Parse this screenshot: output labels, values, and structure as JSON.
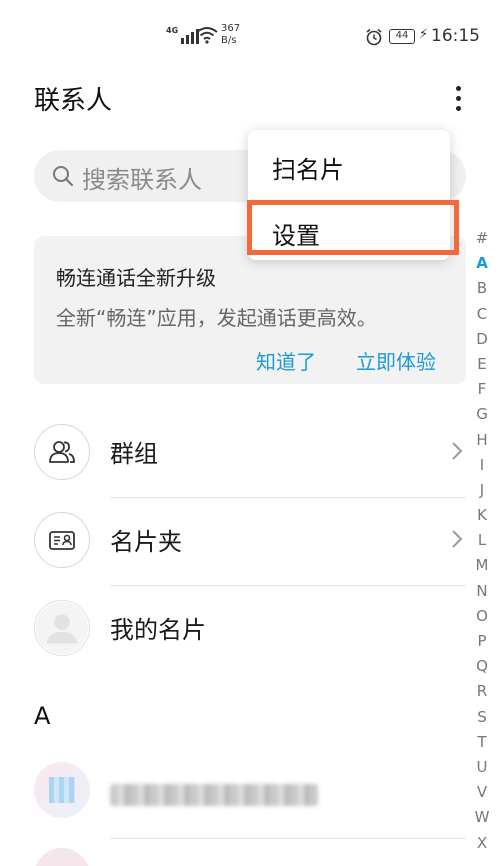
{
  "status_bar": {
    "network": "4G",
    "speed_value": "367",
    "speed_unit": "B/s",
    "battery": "44",
    "time": "16:15"
  },
  "header": {
    "title": "联系人"
  },
  "search": {
    "placeholder": "搜索联系人"
  },
  "banner": {
    "title": "畅连通话全新升级",
    "description": "全新“畅连”应用，发起通话更高效。",
    "dismiss_label": "知道了",
    "try_label": "立即体验"
  },
  "rows": {
    "groups_label": "群组",
    "card_holder_label": "名片夹",
    "my_card_label": "我的名片"
  },
  "section_letter": "A",
  "popup_menu": {
    "items": [
      {
        "label": "扫名片"
      },
      {
        "label": "设置"
      }
    ],
    "highlighted_item": "设置"
  },
  "alphabet_index": [
    "#",
    "A",
    "B",
    "C",
    "D",
    "E",
    "F",
    "G",
    "H",
    "I",
    "J",
    "K",
    "L",
    "M",
    "N",
    "O",
    "P",
    "Q",
    "R",
    "S",
    "T",
    "U",
    "V",
    "W",
    "X"
  ],
  "alphabet_active": "A",
  "colors": {
    "accent": "#1a9bd7",
    "highlight": "#f26a3c"
  }
}
